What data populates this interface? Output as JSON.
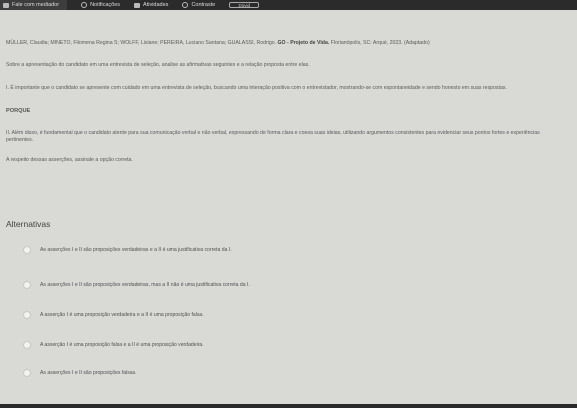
{
  "topbar": {
    "items": [
      {
        "label": "Fale com mediador",
        "icon": "chat-icon"
      },
      {
        "label": "Notificações",
        "icon": "bell-icon"
      },
      {
        "label": "Atividades",
        "icon": "document-icon"
      },
      {
        "label": "Contraste",
        "icon": "contrast-icon"
      }
    ],
    "extra_box": "Dúvid"
  },
  "question": {
    "reference_plain": "MÜLLER, Claudia; MINETO, Filomena Regina S; WOLFF, Lisiane; PEREIRA, Luciano Santana; GUALASSI, Rodrigo.",
    "reference_bold": "GO - Projeto de Vida.",
    "reference_tail": "Florianópolis, SC: Arqué, 2023. (Adaptado)",
    "prompt": "Sobre a apresentação do candidato em uma entrevista de seleção, analise as afirmativas seguintes e a relação proposta entre elas.",
    "assertion_1": "I. É importante que o candidato se apresente com cuidado em uma entrevista de seleção, buscando uma interação positiva com o entrevistador, mostrando-se com espontaneidade e sendo honesto em suas respostas.",
    "connector": "PORQUE",
    "assertion_2": "II. Além disso, é fundamental que o candidato atente para sua comunicação verbal e não verbal, expressando de forma clara e coesa suas ideias, utilizando argumentos consistentes para evidenciar seus pontos fortes e experiências pertinentes.",
    "instruction": "A respeito dessas asserções, assinale a opção correta."
  },
  "alternatives": {
    "title": "Alternativas",
    "options": [
      "As asserções I e II são proposições verdadeiras e a II é uma justificativa correta da I.",
      "As asserções I e II são proposições verdadeiras, mas a II não é uma justificativa correta da I.",
      "A asserção I é uma proposição verdadeira e a II é uma proposição falsa.",
      "A asserção I é uma proposição falsa e a II é uma proposição verdadeira.",
      "As asserções I e II são proposições falsas."
    ]
  }
}
